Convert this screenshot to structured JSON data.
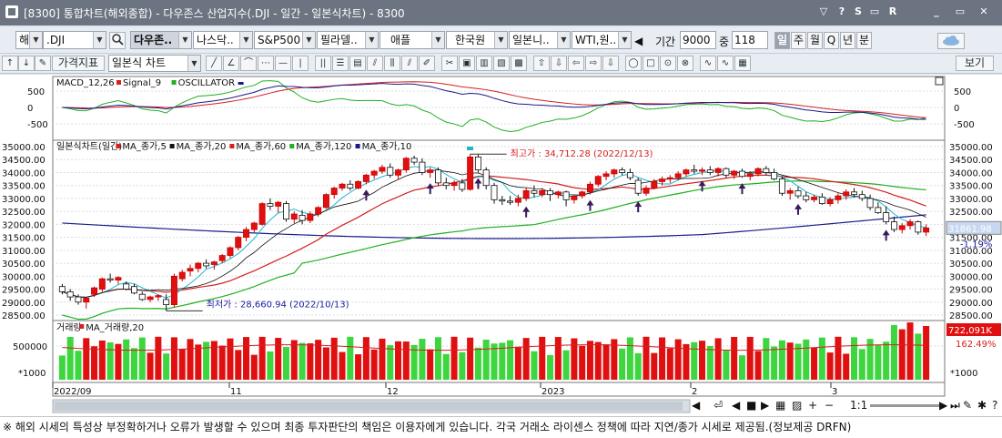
{
  "window": {
    "title": "[8300] 통합차트(해외종합) - 다우존스 산업지수(.DJI - 일간 - 일본식차트) - 8300",
    "buttons": [
      "▽",
      "?",
      "S",
      "▭",
      "R",
      "_",
      "▭",
      "✕"
    ]
  },
  "toolbar": {
    "market": "해",
    "symbol": ".DJI",
    "quick_indices": [
      {
        "label": "다우존..",
        "selected": true
      },
      {
        "label": "나스닥.."
      },
      {
        "label": "S&P500"
      },
      {
        "label": "필라델.."
      },
      {
        "label": "애플"
      },
      {
        "label": "한국원"
      },
      {
        "label": "일본니.."
      },
      {
        "label": "WTI,원.."
      }
    ],
    "period_label": "기간",
    "period_value": "9000",
    "count_label": "중",
    "count_value": "118",
    "periods": [
      {
        "label": "일",
        "active": true
      },
      {
        "label": "주"
      },
      {
        "label": "월"
      },
      {
        "label": "Q"
      },
      {
        "label": "년"
      },
      {
        "label": "분"
      }
    ],
    "indicator_button": "가격지표",
    "chart_type": "일본식 차트",
    "view_button": "보기"
  },
  "macd": {
    "legend": [
      "MACD_12,26",
      "Signal_9",
      "OSCILLATOR"
    ],
    "legend_colors": [
      "#1a1a8a",
      "#d42020",
      "#20b020"
    ],
    "axis_ticks": [
      "500",
      "0",
      "-500"
    ]
  },
  "price": {
    "legend": [
      "일본식차트(일간)",
      "MA_종가,5",
      "MA_종가,20",
      "MA_종가,60",
      "MA_종가,120",
      "MA_종가,10"
    ],
    "legend_colors": [
      "#111111",
      "#d42020",
      "#111111",
      "#d42020",
      "#20b020",
      "#1a1a8a"
    ],
    "high_label": "최고가 : 34,712.28 (2022/12/13)",
    "low_label": "최저가 : 28,660.94 (2022/10/13)",
    "current_price": "31861.98",
    "change_pct": "-1.19%",
    "y_ticks": [
      "35000.00",
      "34500.00",
      "34000.00",
      "33500.00",
      "33000.00",
      "32500.00",
      "32000.00",
      "31500.00",
      "31000.00",
      "30500.00",
      "30000.00",
      "29500.00",
      "29000.00",
      "28500.00"
    ]
  },
  "volume": {
    "legend": [
      "거래량",
      "MA_거래량,20"
    ],
    "y_tick": "500000",
    "unit": "*1000",
    "current": "722,091K",
    "change_pct": "162.49%"
  },
  "x_axis": {
    "labels": [
      "2022/09",
      "11",
      "12",
      "2023",
      "2",
      "3"
    ]
  },
  "nav_bar": {
    "ratio": "1:1"
  },
  "status": {
    "notice": "※ 해외 시세의 특성상 부정확하거나 오류가 발생할 수 있으며 최종 투자판단의 책임은 이용자에게 있습니다. 각국 거래소 라이센스 정책에 따라 지연/종가 시세로 제공됨.(정보제공 DRFN)"
  },
  "chart_data": {
    "type": "candlestick",
    "unit": "index points",
    "ohlc": [
      [
        29600,
        29700,
        29300,
        29400
      ],
      [
        29400,
        29500,
        29050,
        29200
      ],
      [
        29200,
        29300,
        28900,
        29000
      ],
      [
        29000,
        29200,
        28750,
        29150
      ],
      [
        29300,
        29600,
        29200,
        29550
      ],
      [
        29500,
        29950,
        29400,
        29900
      ],
      [
        29900,
        30100,
        29750,
        29850
      ],
      [
        29850,
        30000,
        29700,
        29950
      ],
      [
        29700,
        29800,
        29450,
        29500
      ],
      [
        29600,
        29700,
        29300,
        29350
      ],
      [
        29300,
        29400,
        29050,
        29100
      ],
      [
        29100,
        29250,
        29000,
        29200
      ],
      [
        29200,
        29300,
        29050,
        29250
      ],
      [
        29100,
        29300,
        28661,
        28900
      ],
      [
        28900,
        30100,
        28800,
        30000
      ],
      [
        29900,
        30250,
        29800,
        30150
      ],
      [
        30200,
        30450,
        30000,
        30300
      ],
      [
        30300,
        30550,
        30150,
        30500
      ],
      [
        30500,
        30650,
        30300,
        30400
      ],
      [
        30450,
        30600,
        30250,
        30550
      ],
      [
        30600,
        30850,
        30500,
        30800
      ],
      [
        30800,
        31150,
        30700,
        31100
      ],
      [
        31100,
        31550,
        31000,
        31500
      ],
      [
        31500,
        31900,
        31350,
        31800
      ],
      [
        31800,
        32100,
        31700,
        32050
      ],
      [
        32000,
        32850,
        31950,
        32800
      ],
      [
        32800,
        33000,
        32550,
        32700
      ],
      [
        32700,
        32900,
        32450,
        32850
      ],
      [
        32800,
        32900,
        32100,
        32200
      ],
      [
        32200,
        32500,
        32050,
        32400
      ],
      [
        32350,
        32550,
        32000,
        32150
      ],
      [
        32150,
        32500,
        32050,
        32400
      ],
      [
        32400,
        32700,
        32300,
        32650
      ],
      [
        32650,
        33200,
        32600,
        33150
      ],
      [
        33150,
        33450,
        33000,
        33400
      ],
      [
        33400,
        33600,
        33300,
        33550
      ],
      [
        33550,
        33700,
        33300,
        33400
      ],
      [
        33400,
        33700,
        33350,
        33650
      ],
      [
        33650,
        33950,
        33550,
        33900
      ],
      [
        33900,
        34100,
        33750,
        34050
      ],
      [
        34050,
        34300,
        33950,
        34200
      ],
      [
        34200,
        34350,
        33800,
        33900
      ],
      [
        33900,
        34150,
        33750,
        34100
      ],
      [
        34100,
        34600,
        34000,
        34550
      ],
      [
        34550,
        34650,
        34300,
        34400
      ],
      [
        34400,
        34550,
        33900,
        34000
      ],
      [
        34000,
        34200,
        33800,
        34100
      ],
      [
        34100,
        34200,
        33500,
        33600
      ],
      [
        33600,
        33800,
        33350,
        33500
      ],
      [
        33500,
        33700,
        33300,
        33600
      ],
      [
        33600,
        33750,
        33250,
        33350
      ],
      [
        33350,
        34712,
        33300,
        34600
      ],
      [
        34600,
        34700,
        34000,
        34100
      ],
      [
        34100,
        34200,
        33350,
        33500
      ],
      [
        33500,
        33600,
        32800,
        32950
      ],
      [
        32950,
        33100,
        32750,
        32900
      ],
      [
        32900,
        33100,
        32750,
        32850
      ],
      [
        32850,
        33150,
        32700,
        33000
      ],
      [
        33000,
        33400,
        32900,
        33300
      ],
      [
        33300,
        33500,
        33050,
        33200
      ],
      [
        33150,
        33400,
        33050,
        33300
      ],
      [
        33300,
        33400,
        32900,
        33150
      ],
      [
        33150,
        33300,
        33000,
        33250
      ],
      [
        33250,
        33300,
        32700,
        32950
      ],
      [
        32950,
        33150,
        32800,
        33100
      ],
      [
        33100,
        33300,
        33000,
        33250
      ],
      [
        33250,
        33650,
        33150,
        33550
      ],
      [
        33550,
        33900,
        33450,
        33850
      ],
      [
        33850,
        34050,
        33700,
        33950
      ],
      [
        33950,
        34150,
        33800,
        34100
      ],
      [
        34100,
        34200,
        33900,
        34000
      ],
      [
        34000,
        34150,
        33700,
        33800
      ],
      [
        33700,
        33800,
        33100,
        33200
      ],
      [
        33200,
        33500,
        33100,
        33400
      ],
      [
        33400,
        33750,
        33350,
        33650
      ],
      [
        33650,
        33850,
        33500,
        33750
      ],
      [
        33750,
        33900,
        33600,
        33800
      ],
      [
        33800,
        34050,
        33700,
        33950
      ],
      [
        33950,
        34150,
        33850,
        34100
      ],
      [
        34100,
        34300,
        33950,
        34050
      ],
      [
        34050,
        34200,
        33900,
        34100
      ],
      [
        34100,
        34250,
        33900,
        34000
      ],
      [
        34000,
        34200,
        33850,
        34150
      ],
      [
        34150,
        34200,
        33800,
        33900
      ],
      [
        33900,
        34100,
        33750,
        34050
      ],
      [
        34050,
        34150,
        33800,
        33850
      ],
      [
        33850,
        34050,
        33700,
        33950
      ],
      [
        33950,
        34200,
        33850,
        34150
      ],
      [
        34150,
        34250,
        33900,
        34000
      ],
      [
        34000,
        34150,
        33700,
        33750
      ],
      [
        33750,
        33850,
        33100,
        33200
      ],
      [
        33200,
        33400,
        32950,
        33300
      ],
      [
        33300,
        33450,
        33000,
        33100
      ],
      [
        33100,
        33250,
        32850,
        32950
      ],
      [
        32950,
        33150,
        32850,
        33050
      ],
      [
        33050,
        33200,
        32750,
        32800
      ],
      [
        32800,
        33050,
        32700,
        32950
      ],
      [
        32950,
        33200,
        32800,
        33100
      ],
      [
        33100,
        33350,
        32950,
        33250
      ],
      [
        33250,
        33400,
        33050,
        33150
      ],
      [
        33150,
        33300,
        32900,
        33000
      ],
      [
        33000,
        33150,
        32550,
        32650
      ],
      [
        32650,
        32850,
        32400,
        32450
      ],
      [
        32450,
        32700,
        32000,
        32100
      ],
      [
        32100,
        32300,
        31700,
        31800
      ],
      [
        31800,
        32050,
        31650,
        31950
      ],
      [
        31950,
        32200,
        31800,
        32100
      ],
      [
        32100,
        32150,
        31600,
        31700
      ],
      [
        31700,
        32000,
        31550,
        31862
      ]
    ],
    "y_range": [
      28500,
      35000
    ],
    "high": {
      "value": 34712.28,
      "date": "2022/12/13"
    },
    "low": {
      "value": 28660.94,
      "date": "2022/10/13"
    }
  }
}
